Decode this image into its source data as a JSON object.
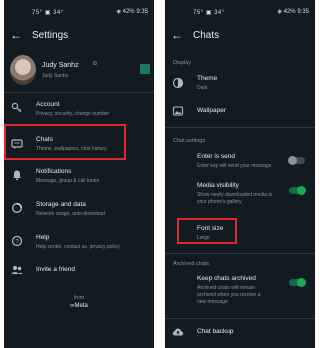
{
  "left": {
    "status": {
      "time": "9:35",
      "battery": "42%",
      "icons": "75° ▣ 34°"
    },
    "header": {
      "title": "Settings"
    },
    "profile": {
      "name": "Judy Sanhz",
      "status": "Judy Sanhz"
    },
    "items": [
      {
        "title": "Account",
        "sub": "Privacy, security, change number"
      },
      {
        "title": "Chats",
        "sub": "Theme, wallpapers, chat history"
      },
      {
        "title": "Notifications",
        "sub": "Message, group & call tones"
      },
      {
        "title": "Storage and data",
        "sub": "Network usage, auto-download"
      },
      {
        "title": "Help",
        "sub": "Help center, contact us, privacy policy"
      },
      {
        "title": "Invite a friend",
        "sub": ""
      }
    ],
    "footer": {
      "from": "from",
      "brand": "∞Meta"
    }
  },
  "right": {
    "status": {
      "time": "9:35",
      "battery": "42%",
      "icons": "75° ▣ 34°"
    },
    "header": {
      "title": "Chats"
    },
    "display_label": "Display",
    "theme": {
      "title": "Theme",
      "sub": "Dark"
    },
    "wallpaper": {
      "title": "Wallpaper"
    },
    "chat_settings_label": "Chat settings",
    "enter_send": {
      "title": "Enter is send",
      "sub": "Enter key will send your message",
      "on": false
    },
    "media_visibility": {
      "title": "Media visibility",
      "sub1": "Show newly downloaded media in",
      "sub2": "your phone's gallery",
      "on": true
    },
    "font_size": {
      "title": "Font size",
      "sub": "Large"
    },
    "archived_label": "Archived chats",
    "keep_archived": {
      "title": "Keep chats archived",
      "sub1": "Archived chats will remain",
      "sub2": "archived when you receive a",
      "sub3": "new message",
      "on": true
    },
    "chat_backup": {
      "title": "Chat backup"
    }
  },
  "colors": {
    "background": "#111b21",
    "accent": "#1fa855",
    "highlight": "#e0262f",
    "muted": "#8696a0"
  }
}
